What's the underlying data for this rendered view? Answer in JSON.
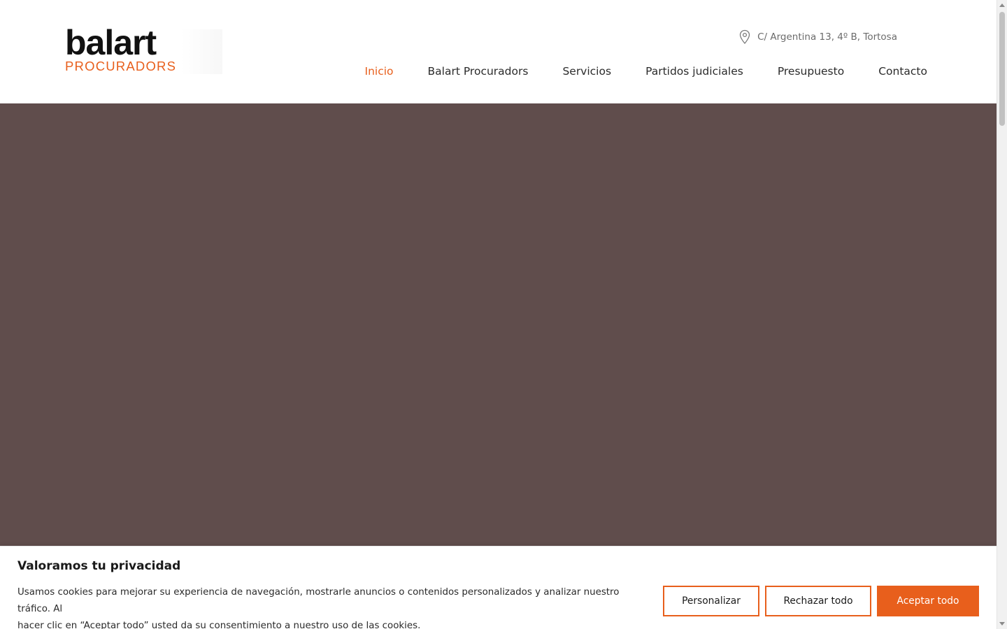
{
  "header": {
    "logo": {
      "main": "balart",
      "sub": "PROCURADORS"
    },
    "address": "C/ Argentina 13, 4º B, Tortosa",
    "nav": [
      {
        "label": "Inicio",
        "active": true
      },
      {
        "label": "Balart Procuradors",
        "active": false
      },
      {
        "label": "Servicios",
        "active": false
      },
      {
        "label": "Partidos judiciales",
        "active": false
      },
      {
        "label": "Presupuesto",
        "active": false
      },
      {
        "label": "Contacto",
        "active": false
      }
    ]
  },
  "hero": {
    "background_color": "#604d4c"
  },
  "cookie_banner": {
    "title": "Valoramos tu privacidad",
    "text_line1": "Usamos cookies para mejorar su experiencia de navegación, mostrarle anuncios o contenidos personalizados y analizar nuestro tráfico. Al",
    "text_line2": "hacer clic en “Aceptar todo” usted da su consentimiento a nuestro uso de las cookies.",
    "buttons": {
      "customize": "Personalizar",
      "reject": "Rechazar todo",
      "accept": "Aceptar todo"
    }
  },
  "colors": {
    "accent": "#e85f1c",
    "text_dark": "#2b2b2b",
    "hero": "#604d4c"
  },
  "icons": {
    "address": "map-pin-icon"
  }
}
